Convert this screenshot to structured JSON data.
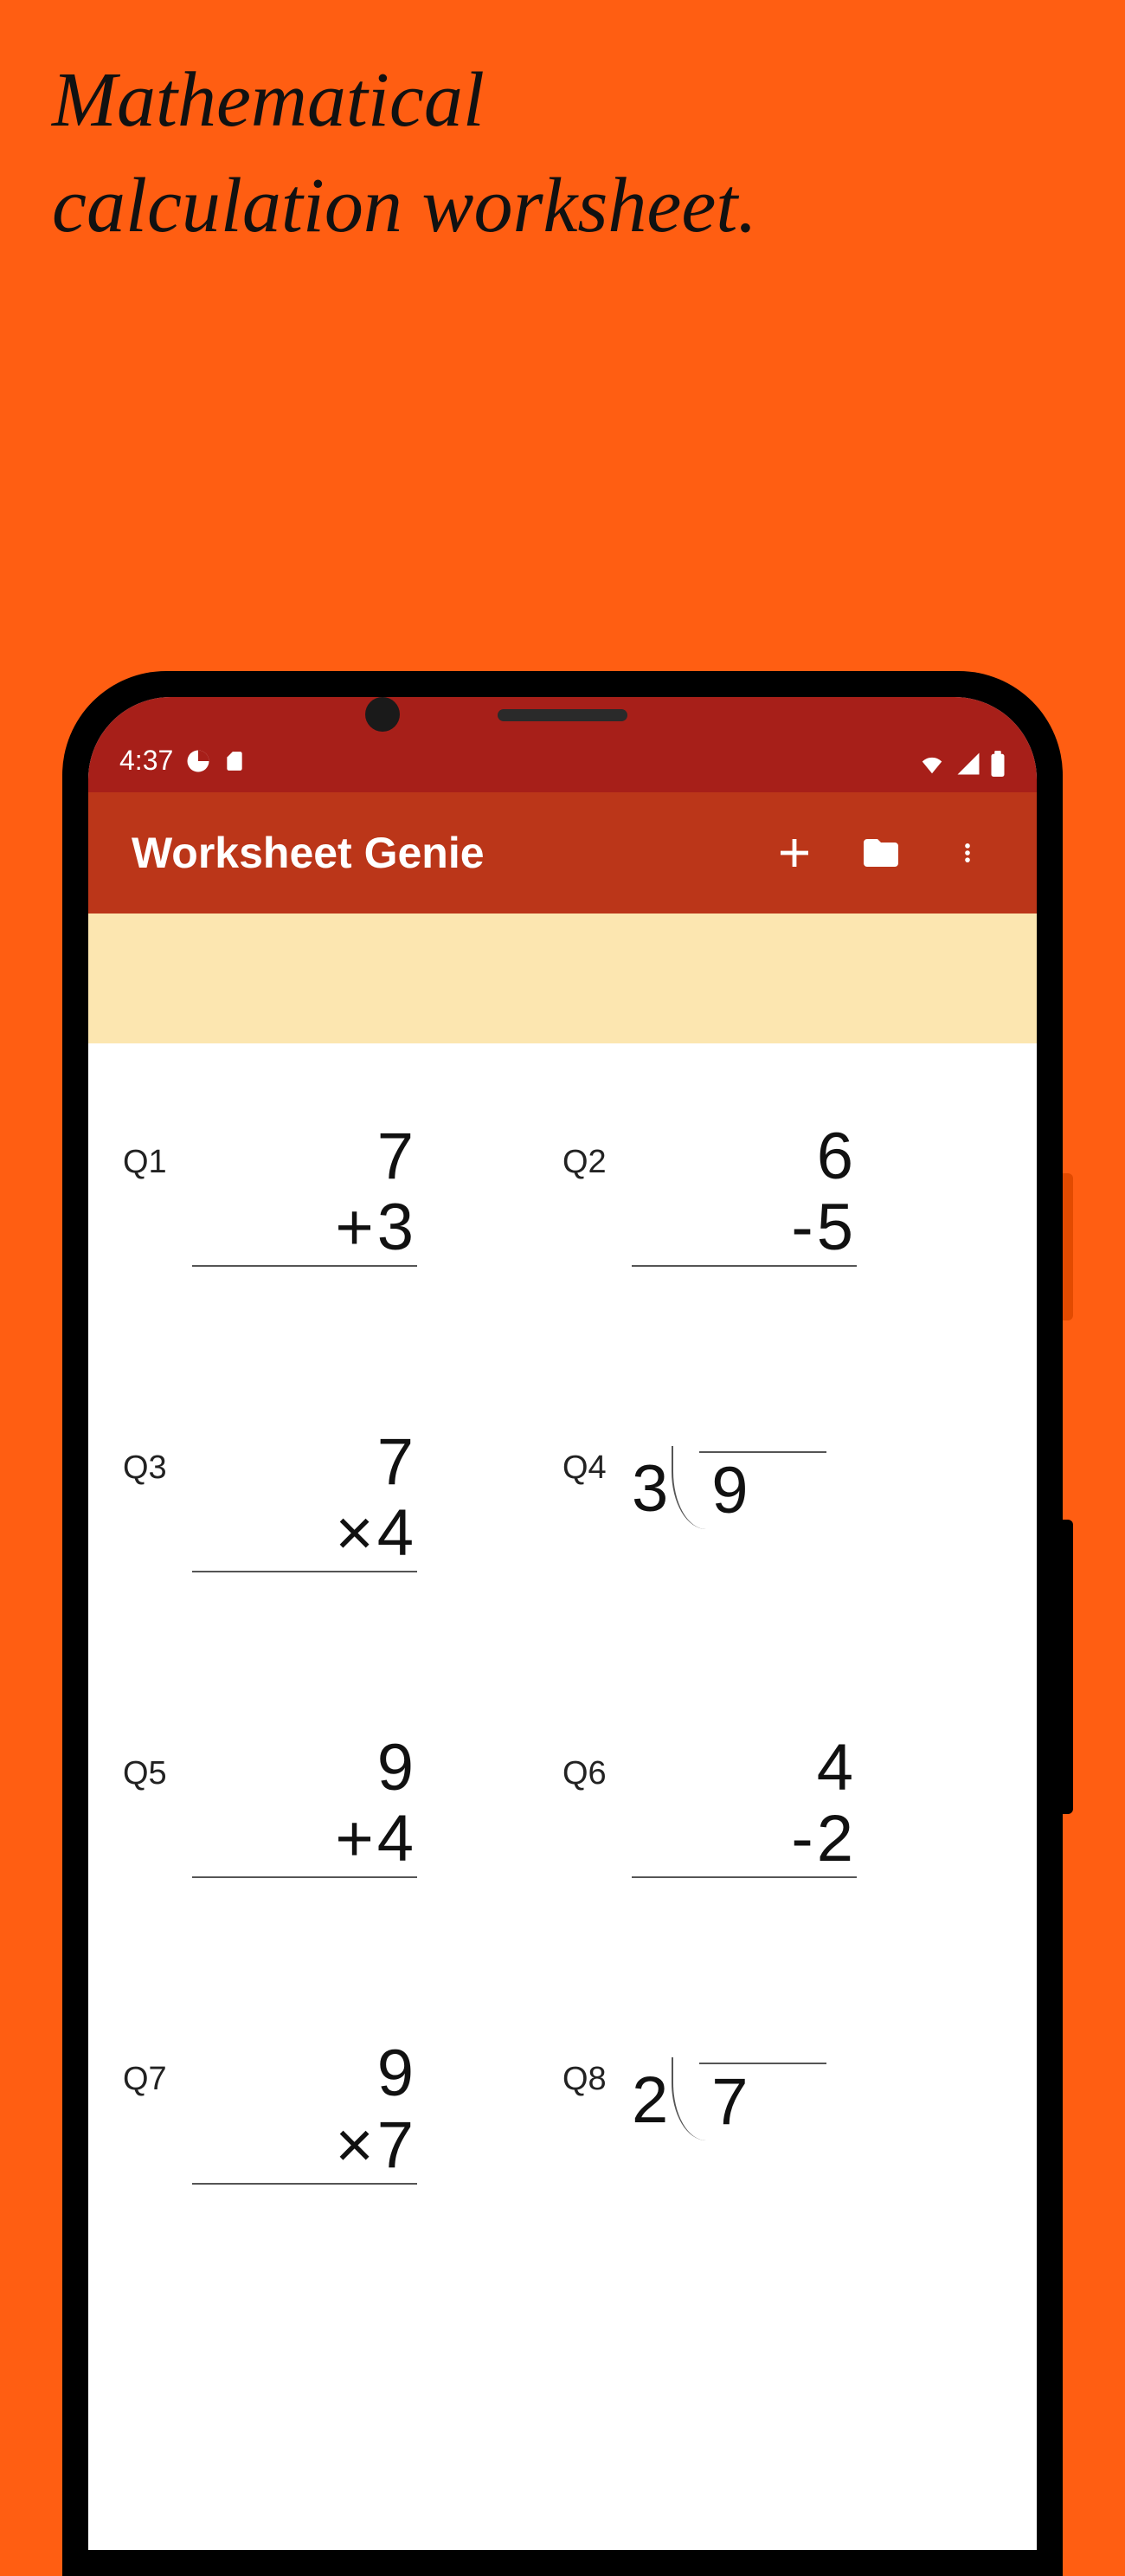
{
  "promo": {
    "title_line1": "Mathematical",
    "title_line2": "calculation worksheet."
  },
  "colors": {
    "background": "#ff5e12",
    "status_bar": "#a71f19",
    "app_bar": "#bb3619",
    "cream": "#fce6b0"
  },
  "status": {
    "time": "4:37",
    "icons_left": [
      "timer-icon",
      "sd-card-icon"
    ],
    "icons_right": [
      "wifi-icon",
      "signal-icon",
      "battery-icon"
    ]
  },
  "appbar": {
    "title": "Worksheet Genie",
    "actions": [
      {
        "name": "add-button",
        "icon": "plus-icon"
      },
      {
        "name": "folder-button",
        "icon": "folder-icon"
      },
      {
        "name": "more-button",
        "icon": "more-vert-icon"
      }
    ]
  },
  "worksheet": {
    "problems": [
      {
        "id": "Q1",
        "type": "stack",
        "top": "7",
        "op": "+",
        "bottom": "3"
      },
      {
        "id": "Q2",
        "type": "stack",
        "top": "6",
        "op": "-",
        "bottom": "5"
      },
      {
        "id": "Q3",
        "type": "stack",
        "top": "7",
        "op": "×",
        "bottom": "4"
      },
      {
        "id": "Q4",
        "type": "division",
        "divisor": "3",
        "dividend": "9"
      },
      {
        "id": "Q5",
        "type": "stack",
        "top": "9",
        "op": "+",
        "bottom": "4"
      },
      {
        "id": "Q6",
        "type": "stack",
        "top": "4",
        "op": "-",
        "bottom": "2"
      },
      {
        "id": "Q7",
        "type": "stack",
        "top": "9",
        "op": "×",
        "bottom": "7"
      },
      {
        "id": "Q8",
        "type": "division",
        "divisor": "2",
        "dividend": "7"
      }
    ]
  }
}
